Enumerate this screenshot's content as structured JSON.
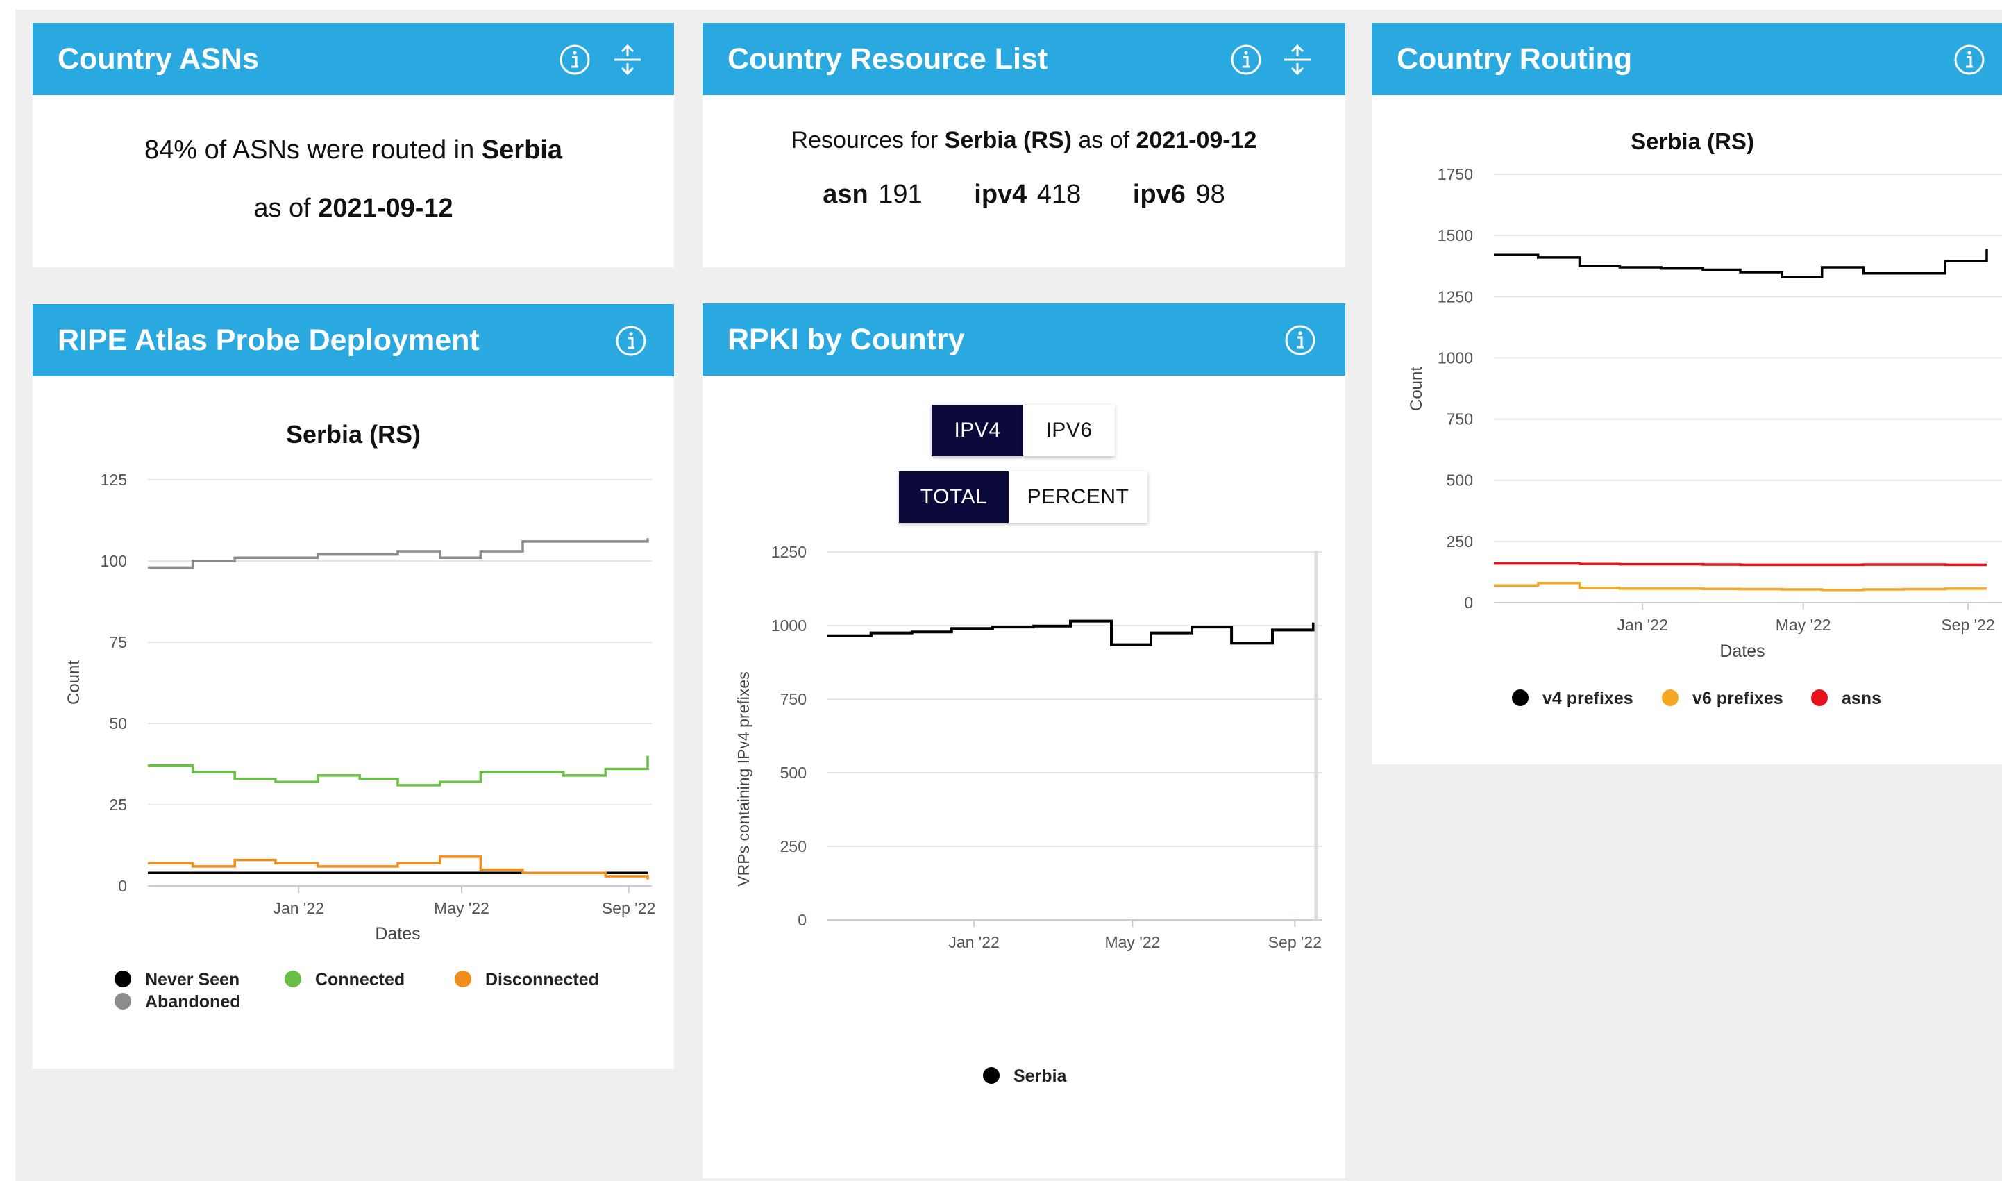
{
  "asns": {
    "title": "Country ASNs",
    "line1_pre": "84% of ASNs were routed in ",
    "line1_country": "Serbia",
    "line2_pre": "as of ",
    "line2_date": "2021-09-12"
  },
  "resources": {
    "title": "Country Resource List",
    "line_pre": "Resources for ",
    "country": "Serbia (RS)",
    "line_mid": " as of ",
    "date": "2021-09-12",
    "items": [
      {
        "label": "asn",
        "value": "191"
      },
      {
        "label": "ipv4",
        "value": "418"
      },
      {
        "label": "ipv6",
        "value": "98"
      }
    ]
  },
  "routing": {
    "title": "Country Routing",
    "chart_title": "Serbia (RS)",
    "ylabel": "Count",
    "xlabel": "Dates",
    "yticks": [
      "1750",
      "1500",
      "1250",
      "1000",
      "750",
      "500",
      "250",
      "0"
    ],
    "xticks": [
      "Jan '22",
      "May '22",
      "Sep '22"
    ],
    "legend": [
      "v4 prefixes",
      "v6 prefixes",
      "asns"
    ]
  },
  "atlas": {
    "title": "RIPE Atlas Probe Deployment",
    "chart_title": "Serbia (RS)",
    "ylabel": "Count",
    "xlabel": "Dates",
    "yticks": [
      "125",
      "100",
      "75",
      "50",
      "25",
      "0"
    ],
    "xticks": [
      "Jan '22",
      "May '22",
      "Sep '22"
    ],
    "legend": [
      "Never Seen",
      "Connected",
      "Disconnected",
      "Abandoned"
    ]
  },
  "rpki": {
    "title": "RPKI by Country",
    "toggle1": [
      "IPV4",
      "IPV6"
    ],
    "toggle2": [
      "TOTAL",
      "PERCENT"
    ],
    "ylabel": "VRPs containing IPv4 prefixes",
    "yticks": [
      "1250",
      "1000",
      "750",
      "500",
      "250",
      "0"
    ],
    "xticks": [
      "Jan '22",
      "May '22",
      "Sep '22"
    ],
    "legend": [
      "Serbia"
    ]
  },
  "colors": {
    "header": "#2aa9e0",
    "v4": "#000000",
    "v6": "#f5a623",
    "asns": "#e8111c",
    "never_seen": "#000000",
    "connected": "#6abf45",
    "disconnected": "#f28c1b",
    "abandoned": "#8c8c8c",
    "serbia": "#000000"
  },
  "chart_data": [
    {
      "type": "line",
      "title": "Serbia (RS)",
      "xlabel": "Dates",
      "ylabel": "Count",
      "ylim": [
        0,
        1750
      ],
      "x": [
        "2021-09-12",
        "2021-10-15",
        "2021-11-15",
        "2021-12-15",
        "2022-01-15",
        "2022-02-15",
        "2022-03-15",
        "2022-04-15",
        "2022-05-15",
        "2022-06-15",
        "2022-07-15",
        "2022-08-15",
        "2022-09-15"
      ],
      "series": [
        {
          "name": "v4 prefixes",
          "values": [
            1420,
            1410,
            1375,
            1370,
            1365,
            1360,
            1350,
            1330,
            1370,
            1345,
            1345,
            1395,
            1445
          ]
        },
        {
          "name": "v6 prefixes",
          "values": [
            70,
            80,
            60,
            57,
            57,
            56,
            55,
            54,
            52,
            54,
            55,
            57,
            57
          ]
        },
        {
          "name": "asns",
          "values": [
            160,
            160,
            158,
            157,
            157,
            156,
            155,
            155,
            155,
            156,
            156,
            155,
            155
          ]
        }
      ],
      "grid": true,
      "legend": "bottom"
    },
    {
      "type": "line",
      "title": "Serbia (RS)",
      "xlabel": "Dates",
      "ylabel": "Count",
      "ylim": [
        0,
        125
      ],
      "x": [
        "2021-09-12",
        "2021-10-15",
        "2021-11-15",
        "2021-12-15",
        "2022-01-15",
        "2022-02-15",
        "2022-03-15",
        "2022-04-15",
        "2022-05-15",
        "2022-06-15",
        "2022-07-15",
        "2022-08-15",
        "2022-09-15"
      ],
      "series": [
        {
          "name": "Never Seen",
          "values": [
            4,
            4,
            4,
            4,
            4,
            4,
            4,
            4,
            4,
            4,
            4,
            4,
            4
          ]
        },
        {
          "name": "Connected",
          "values": [
            37,
            35,
            33,
            32,
            34,
            33,
            31,
            32,
            35,
            35,
            34,
            36,
            40
          ]
        },
        {
          "name": "Disconnected",
          "values": [
            7,
            6,
            8,
            7,
            6,
            6,
            7,
            9,
            5,
            4,
            4,
            3,
            2
          ]
        },
        {
          "name": "Abandoned",
          "values": [
            98,
            100,
            101,
            101,
            102,
            102,
            103,
            101,
            103,
            106,
            106,
            106,
            107
          ]
        }
      ],
      "grid": true,
      "legend": "bottom"
    },
    {
      "type": "line",
      "xlabel": "",
      "ylabel": "VRPs containing IPv4 prefixes",
      "ylim": [
        0,
        1250
      ],
      "x": [
        "2021-09-12",
        "2021-10-15",
        "2021-11-15",
        "2021-12-15",
        "2022-01-15",
        "2022-02-15",
        "2022-03-15",
        "2022-04-15",
        "2022-05-15",
        "2022-06-15",
        "2022-07-15",
        "2022-08-15",
        "2022-09-15"
      ],
      "series": [
        {
          "name": "Serbia",
          "values": [
            965,
            975,
            978,
            990,
            995,
            998,
            1015,
            935,
            975,
            995,
            940,
            985,
            1010
          ]
        }
      ],
      "grid": true,
      "legend": "bottom"
    }
  ]
}
